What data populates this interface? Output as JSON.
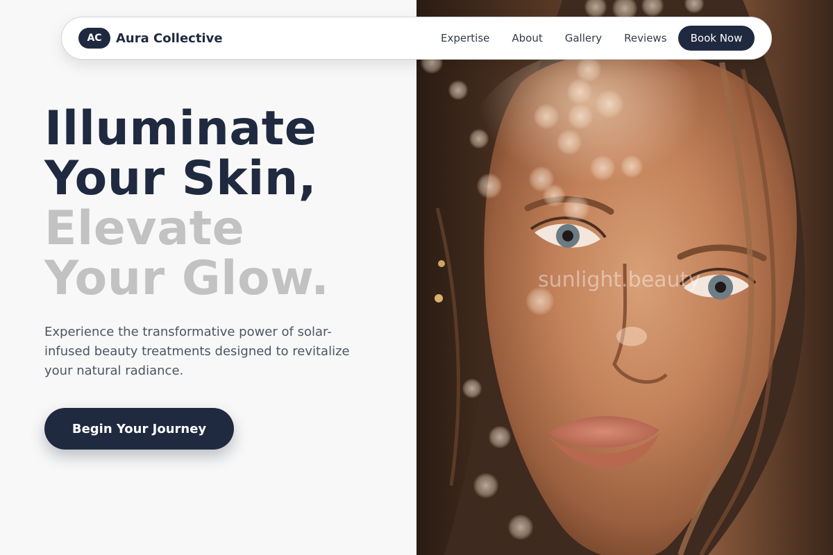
{
  "brand": {
    "badge": "AC",
    "name": "Aura Collective"
  },
  "nav": {
    "links": [
      "Expertise",
      "About",
      "Gallery",
      "Reviews"
    ],
    "cta_label": "Book Now"
  },
  "hero": {
    "headline_dark": [
      "Illuminate",
      "Your Skin,"
    ],
    "headline_light": [
      "Elevate",
      "Your Glow."
    ],
    "subcopy": "Experience the transformative power of solar-infused beauty treatments designed to revitalize your natural radiance.",
    "cta_label": "Begin Your Journey"
  },
  "photo": {
    "watermark": "sunlight.beauty"
  },
  "colors": {
    "primary": "#1f2a40",
    "headline_muted": "#c2c2c2",
    "background": "#f8f8f8",
    "body_text": "#4b5563"
  }
}
